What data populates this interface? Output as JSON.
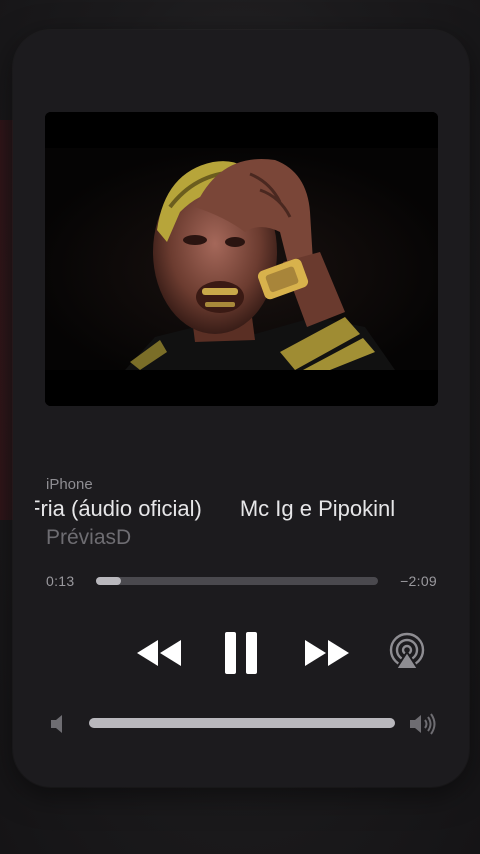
{
  "now_playing": {
    "source": "iPhone",
    "title": "Fria (áudio oficial)",
    "title_next": "Mc Ig e Pipokinl",
    "artist": "PréviasD"
  },
  "playback": {
    "elapsed": "0:13",
    "remaining": "−2:09",
    "progress_fraction": 0.09,
    "volume_fraction": 1.0
  },
  "icons": {
    "rewind": "rewind-icon",
    "pause": "pause-icon",
    "forward": "fast-forward-icon",
    "airplay": "airplay-icon",
    "volume_low": "speaker-low-icon",
    "volume_high": "speaker-high-icon"
  },
  "colors": {
    "card_bg": "#1c1b1e",
    "text_primary": "#e6e6e8",
    "text_secondary": "#6e6d72",
    "track_bg": "#4a494e",
    "track_fill": "#b9b8bd"
  }
}
